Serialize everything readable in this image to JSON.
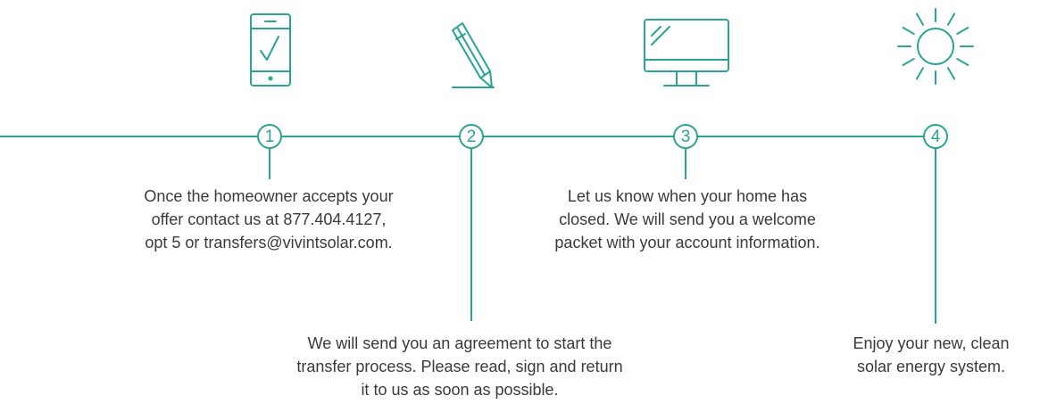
{
  "theme": {
    "accent": "#2aa592",
    "text": "#3a3a3a"
  },
  "steps": [
    {
      "number": "1",
      "icon": "smartphone-check-icon",
      "lines": [
        "Once the homeowner accepts your",
        "offer contact us at 877.404.4127,",
        "opt 5 or transfers@vivintsolar.com."
      ]
    },
    {
      "number": "2",
      "icon": "pencil-sign-icon",
      "lines": [
        "We will send you an agreement to start the",
        "transfer process. Please read, sign and return",
        "it to us as soon as possible."
      ]
    },
    {
      "number": "3",
      "icon": "monitor-icon",
      "lines": [
        "Let us know when your home has",
        "closed. We will send you a welcome",
        "packet with your account information."
      ]
    },
    {
      "number": "4",
      "icon": "sun-icon",
      "lines": [
        "Enjoy your new, clean",
        "solar energy system."
      ]
    }
  ]
}
